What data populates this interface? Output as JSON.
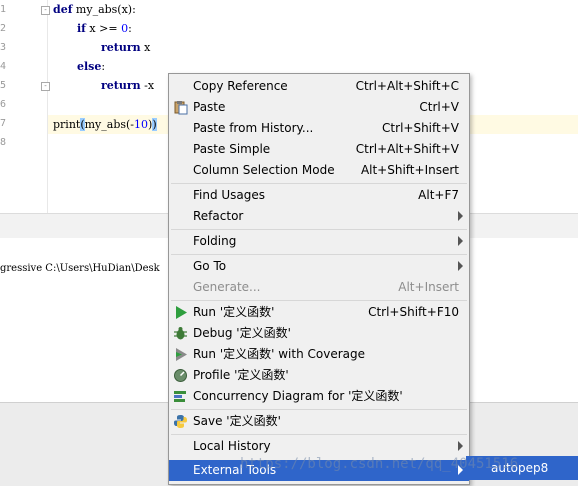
{
  "editor": {
    "line_numbers": [
      "1",
      "2",
      "3",
      "4",
      "5",
      "6",
      "7",
      "8"
    ],
    "code": {
      "l1_kw": "def",
      "l1_rest": " my_abs(x):",
      "l2_kw": "if",
      "l2_rest": " x >= ",
      "l2_num": "0",
      "l2_end": ":",
      "l3_kw": "return",
      "l3_rest": " x",
      "l4_kw": "else",
      "l4_rest": ":",
      "l5_kw": "return",
      "l5_rest": " -x",
      "l7_a": "print",
      "l7_b": "(",
      "l7_c": "my_abs(-",
      "l7_num": "10",
      "l7_d": ")",
      "l7_e": ")"
    }
  },
  "console": {
    "text": "gressive C:\\Users\\HuDian\\Desk"
  },
  "context_menu": {
    "items": [
      {
        "label": "Copy Reference",
        "shortcut": "Ctrl+Alt+Shift+C"
      },
      {
        "label": "Paste",
        "shortcut": "Ctrl+V"
      },
      {
        "label": "Paste from History...",
        "shortcut": "Ctrl+Shift+V"
      },
      {
        "label": "Paste Simple",
        "shortcut": "Ctrl+Alt+Shift+V"
      },
      {
        "label": "Column Selection Mode",
        "shortcut": "Alt+Shift+Insert"
      },
      {
        "label": "Find Usages",
        "shortcut": "Alt+F7"
      },
      {
        "label": "Refactor",
        "shortcut": ""
      },
      {
        "label": "Folding",
        "shortcut": ""
      },
      {
        "label": "Go To",
        "shortcut": ""
      },
      {
        "label": "Generate...",
        "shortcut": "Alt+Insert"
      },
      {
        "label": "Run '定义函数'",
        "shortcut": "Ctrl+Shift+F10"
      },
      {
        "label": "Debug '定义函数'",
        "shortcut": ""
      },
      {
        "label": "Run '定义函数' with Coverage",
        "shortcut": ""
      },
      {
        "label": "Profile '定义函数'",
        "shortcut": ""
      },
      {
        "label": "Concurrency Diagram for '定义函数'",
        "shortcut": ""
      },
      {
        "label": "Save '定义函数'",
        "shortcut": ""
      },
      {
        "label": "Local History",
        "shortcut": ""
      },
      {
        "label": "External Tools",
        "shortcut": ""
      }
    ]
  },
  "submenu": {
    "label": "autopep8"
  },
  "watermark": "https://blog.csdn.net/qq_40451516",
  "colors": {
    "selection": "#2f65ca",
    "run_icon": "#2e9e3e",
    "keyword": "#000080",
    "number": "#0000ff",
    "current_line": "#fffae3"
  }
}
